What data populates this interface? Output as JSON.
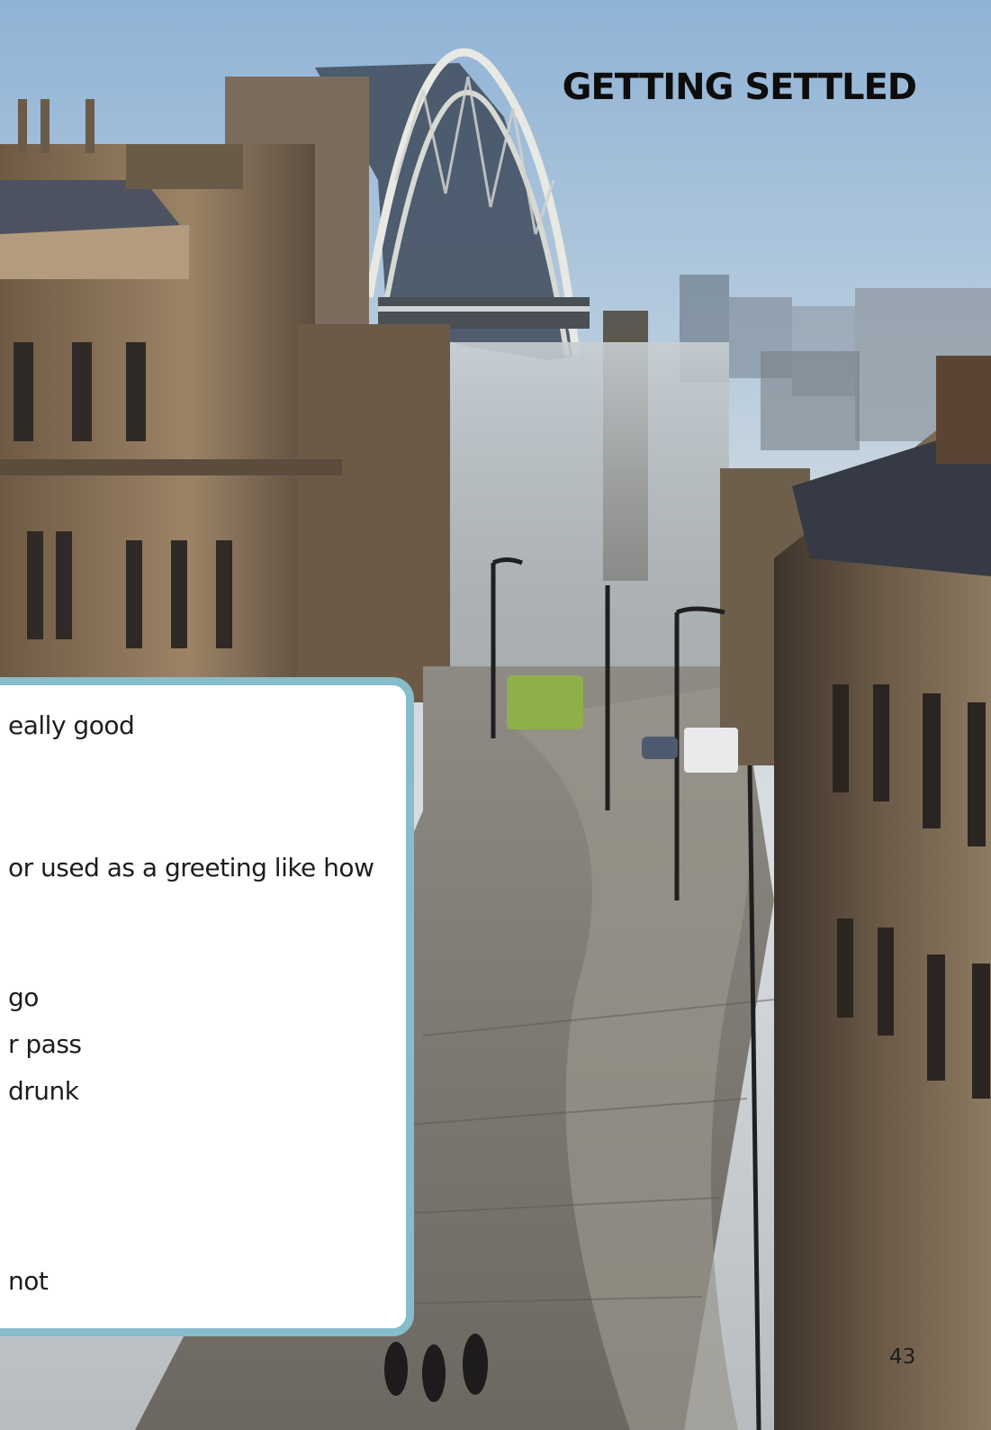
{
  "page": {
    "section_title": "GETTING SETTLED",
    "page_number": "43"
  },
  "glossary_lines": [
    "eally good",
    "or used as a greeting like how",
    "go",
    "r pass",
    "drunk",
    "not"
  ],
  "colors": {
    "box_border": "#86bdcc",
    "box_fill": "#ffffff",
    "title_text": "#0d0d0d"
  }
}
